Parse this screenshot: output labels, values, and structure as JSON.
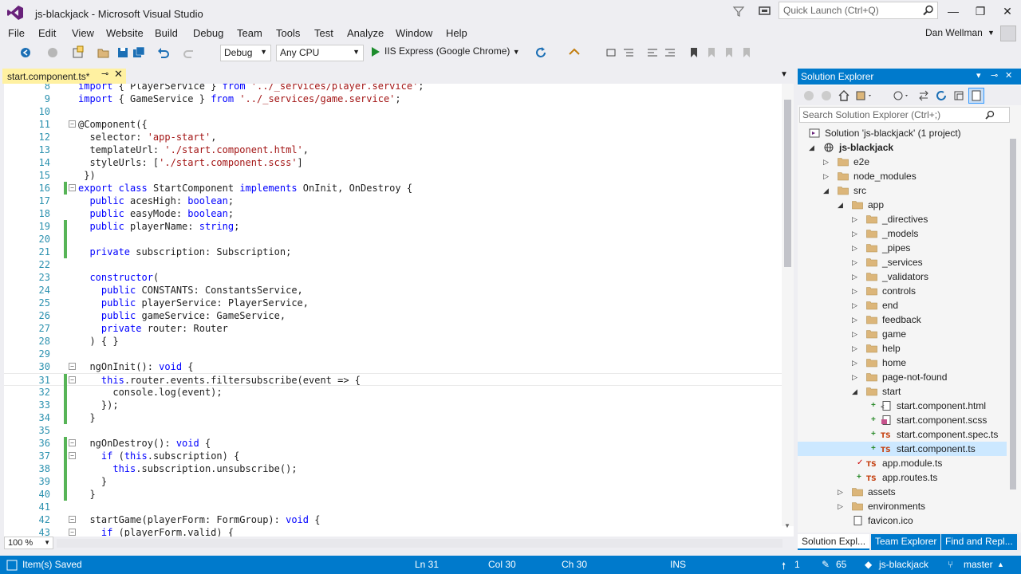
{
  "window": {
    "title": "js-blackjack - Microsoft Visual Studio",
    "quick_launch_placeholder": "Quick Launch (Ctrl+Q)",
    "minimize": "—",
    "maximize": "❐",
    "close": "✕"
  },
  "menus": [
    "File",
    "Edit",
    "View",
    "Website",
    "Build",
    "Debug",
    "Team",
    "Tools",
    "Test",
    "Analyze",
    "Window",
    "Help"
  ],
  "user": {
    "name": "Dan Wellman"
  },
  "toolbar": {
    "configuration": "Debug",
    "platform": "Any CPU",
    "run_target": "IIS Express (Google Chrome)"
  },
  "tab": {
    "label": "start.component.ts*"
  },
  "editor": {
    "zoom": "100 %",
    "lines": [
      {
        "n": "8",
        "text": "import { PlayerService } from '../_services/player.service';",
        "fold": "",
        "chg": ""
      },
      {
        "n": "9",
        "text": "import { GameService } from '../_services/game.service';",
        "fold": "",
        "chg": ""
      },
      {
        "n": "10",
        "text": "",
        "fold": "",
        "chg": ""
      },
      {
        "n": "11",
        "text": "@Component({",
        "fold": "−",
        "chg": ""
      },
      {
        "n": "12",
        "text": "  selector: 'app-start',",
        "fold": "",
        "chg": ""
      },
      {
        "n": "13",
        "text": "  templateUrl: './start.component.html',",
        "fold": "",
        "chg": ""
      },
      {
        "n": "14",
        "text": "  styleUrls: ['./start.component.scss']",
        "fold": "",
        "chg": ""
      },
      {
        "n": "15",
        "text": " })",
        "fold": "",
        "chg": ""
      },
      {
        "n": "16",
        "text": "export class StartComponent implements OnInit, OnDestroy {",
        "fold": "−",
        "chg": "saved"
      },
      {
        "n": "17",
        "text": "  public acesHigh: boolean;",
        "fold": "",
        "chg": ""
      },
      {
        "n": "18",
        "text": "  public easyMode: boolean;",
        "fold": "",
        "chg": ""
      },
      {
        "n": "19",
        "text": "  public playerName: string;",
        "fold": "",
        "chg": "saved"
      },
      {
        "n": "20",
        "text": "",
        "fold": "",
        "chg": "saved"
      },
      {
        "n": "21",
        "text": "  private subscription: Subscription;",
        "fold": "",
        "chg": "saved"
      },
      {
        "n": "22",
        "text": "",
        "fold": "",
        "chg": ""
      },
      {
        "n": "23",
        "text": "  constructor(",
        "fold": "",
        "chg": ""
      },
      {
        "n": "24",
        "text": "    public CONSTANTS: ConstantsService,",
        "fold": "",
        "chg": ""
      },
      {
        "n": "25",
        "text": "    public playerService: PlayerService,",
        "fold": "",
        "chg": ""
      },
      {
        "n": "26",
        "text": "    public gameService: GameService,",
        "fold": "",
        "chg": ""
      },
      {
        "n": "27",
        "text": "    private router: Router",
        "fold": "",
        "chg": ""
      },
      {
        "n": "28",
        "text": "  ) { }",
        "fold": "",
        "chg": ""
      },
      {
        "n": "29",
        "text": "",
        "fold": "",
        "chg": ""
      },
      {
        "n": "30",
        "text": "  ngOnInit(): void {",
        "fold": "−",
        "chg": ""
      },
      {
        "n": "31",
        "text": "    this.router.events.filtersubscribe(event => {",
        "fold": "−",
        "chg": "saved"
      },
      {
        "n": "32",
        "text": "      console.log(event);",
        "fold": "",
        "chg": "saved"
      },
      {
        "n": "33",
        "text": "    });",
        "fold": "",
        "chg": "saved"
      },
      {
        "n": "34",
        "text": "  }",
        "fold": "",
        "chg": "saved"
      },
      {
        "n": "35",
        "text": "",
        "fold": "",
        "chg": ""
      },
      {
        "n": "36",
        "text": "  ngOnDestroy(): void {",
        "fold": "−",
        "chg": "saved"
      },
      {
        "n": "37",
        "text": "    if (this.subscription) {",
        "fold": "−",
        "chg": "saved"
      },
      {
        "n": "38",
        "text": "      this.subscription.unsubscribe();",
        "fold": "",
        "chg": "saved"
      },
      {
        "n": "39",
        "text": "    }",
        "fold": "",
        "chg": "saved"
      },
      {
        "n": "40",
        "text": "  }",
        "fold": "",
        "chg": "saved"
      },
      {
        "n": "41",
        "text": "",
        "fold": "",
        "chg": ""
      },
      {
        "n": "42",
        "text": "  startGame(playerForm: FormGroup): void {",
        "fold": "−",
        "chg": ""
      },
      {
        "n": "43",
        "text": "    if (playerForm.valid) {",
        "fold": "−",
        "chg": ""
      }
    ]
  },
  "solution_explorer": {
    "title": "Solution Explorer",
    "search_placeholder": "Search Solution Explorer (Ctrl+;)",
    "nodes": [
      {
        "label": "Solution 'js-blackjack' (1 project)",
        "depth": 0,
        "arrow": "",
        "icon": "solution",
        "status": ""
      },
      {
        "label": "js-blackjack",
        "depth": 1,
        "arrow": "◢",
        "icon": "web",
        "status": "",
        "bold": true
      },
      {
        "label": "e2e",
        "depth": 2,
        "arrow": "▷",
        "icon": "folder",
        "status": ""
      },
      {
        "label": "node_modules",
        "depth": 2,
        "arrow": "▷",
        "icon": "folder",
        "status": ""
      },
      {
        "label": "src",
        "depth": 2,
        "arrow": "◢",
        "icon": "folder",
        "status": ""
      },
      {
        "label": "app",
        "depth": 3,
        "arrow": "◢",
        "icon": "folder",
        "status": ""
      },
      {
        "label": "_directives",
        "depth": 4,
        "arrow": "▷",
        "icon": "folder",
        "status": ""
      },
      {
        "label": "_models",
        "depth": 4,
        "arrow": "▷",
        "icon": "folder",
        "status": ""
      },
      {
        "label": "_pipes",
        "depth": 4,
        "arrow": "▷",
        "icon": "folder",
        "status": ""
      },
      {
        "label": "_services",
        "depth": 4,
        "arrow": "▷",
        "icon": "folder",
        "status": ""
      },
      {
        "label": "_validators",
        "depth": 4,
        "arrow": "▷",
        "icon": "folder",
        "status": ""
      },
      {
        "label": "controls",
        "depth": 4,
        "arrow": "▷",
        "icon": "folder",
        "status": ""
      },
      {
        "label": "end",
        "depth": 4,
        "arrow": "▷",
        "icon": "folder",
        "status": ""
      },
      {
        "label": "feedback",
        "depth": 4,
        "arrow": "▷",
        "icon": "folder",
        "status": ""
      },
      {
        "label": "game",
        "depth": 4,
        "arrow": "▷",
        "icon": "folder",
        "status": ""
      },
      {
        "label": "help",
        "depth": 4,
        "arrow": "▷",
        "icon": "folder",
        "status": ""
      },
      {
        "label": "home",
        "depth": 4,
        "arrow": "▷",
        "icon": "folder",
        "status": ""
      },
      {
        "label": "page-not-found",
        "depth": 4,
        "arrow": "▷",
        "icon": "folder",
        "status": ""
      },
      {
        "label": "start",
        "depth": 4,
        "arrow": "◢",
        "icon": "folder",
        "status": ""
      },
      {
        "label": "start.component.html",
        "depth": 5,
        "arrow": "",
        "icon": "html",
        "status": "+"
      },
      {
        "label": "start.component.scss",
        "depth": 5,
        "arrow": "",
        "icon": "scss",
        "status": "+"
      },
      {
        "label": "start.component.spec.ts",
        "depth": 5,
        "arrow": "",
        "icon": "ts",
        "status": "+"
      },
      {
        "label": "start.component.ts",
        "depth": 5,
        "arrow": "",
        "icon": "ts",
        "status": "+",
        "selected": true
      },
      {
        "label": "app.module.ts",
        "depth": 4,
        "arrow": "",
        "icon": "ts",
        "status": "✓"
      },
      {
        "label": "app.routes.ts",
        "depth": 4,
        "arrow": "",
        "icon": "ts",
        "status": "+"
      },
      {
        "label": "assets",
        "depth": 3,
        "arrow": "▷",
        "icon": "folder",
        "status": ""
      },
      {
        "label": "environments",
        "depth": 3,
        "arrow": "▷",
        "icon": "folder",
        "status": ""
      },
      {
        "label": "favicon.ico",
        "depth": 3,
        "arrow": "",
        "icon": "file",
        "status": ""
      }
    ],
    "tabs": [
      "Solution Expl...",
      "Team Explorer",
      "Find and Repl..."
    ]
  },
  "status": {
    "message": "Item(s) Saved",
    "line": "Ln 31",
    "col": "Col 30",
    "ch": "Ch 30",
    "mode": "INS",
    "push": "1",
    "changes": "65",
    "repo": "js-blackjack",
    "branch": "master"
  },
  "colors": {
    "accent": "#007acc",
    "tab_modified": "#fff1a1",
    "saved_change": "#57b457",
    "keyword": "#0000ff",
    "string": "#a31515"
  }
}
